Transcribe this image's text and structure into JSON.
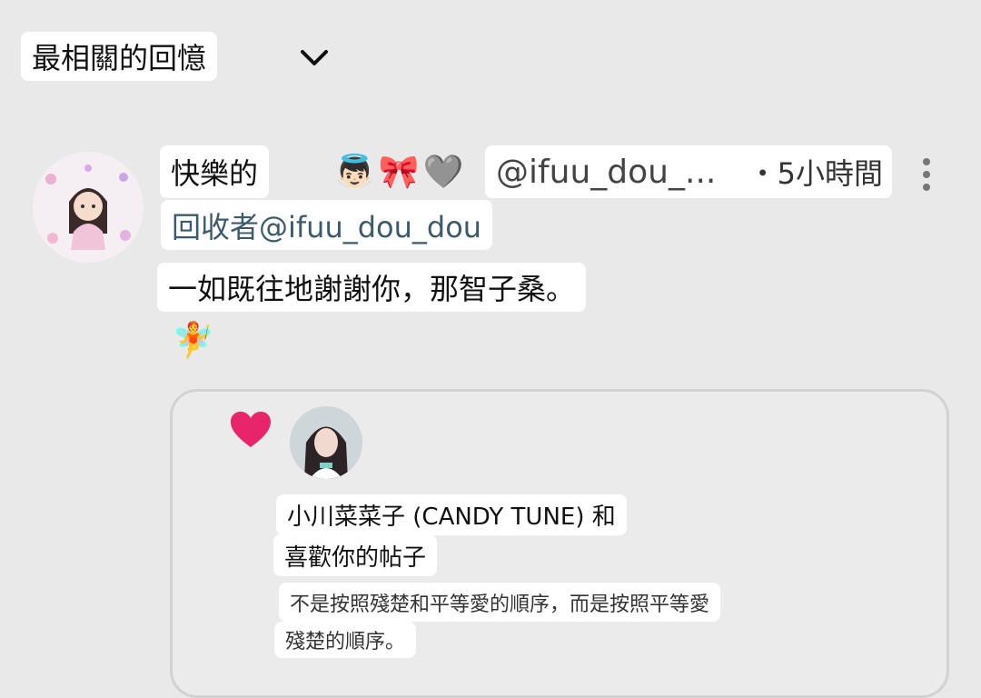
{
  "header": {
    "sort_label": "最相關的回憶"
  },
  "post": {
    "username": "快樂的",
    "emojis": [
      "👼🏻",
      "🎀",
      "🩶"
    ],
    "handle": "@ifuu_dou_...",
    "time": "・5小時間",
    "reply_to": "回收者@ifuu_dou_dou",
    "body": "一如既往地謝謝你，那智子桑。",
    "trailing_emoji": "🧚"
  },
  "notification_card": {
    "liker_line": "小川菜菜子 (CANDY TUNE) 和",
    "liked_line": "喜歡你的帖子",
    "quote_line1": "不是按照殘楚和平等愛的順序，而是按照平等愛",
    "quote_line2": "殘楚的順序。"
  },
  "colors": {
    "background": "#e9e9e9",
    "label_bg": "#ffffff",
    "heart": "#e8246b",
    "reply_to_text": "#3c5a6b"
  }
}
